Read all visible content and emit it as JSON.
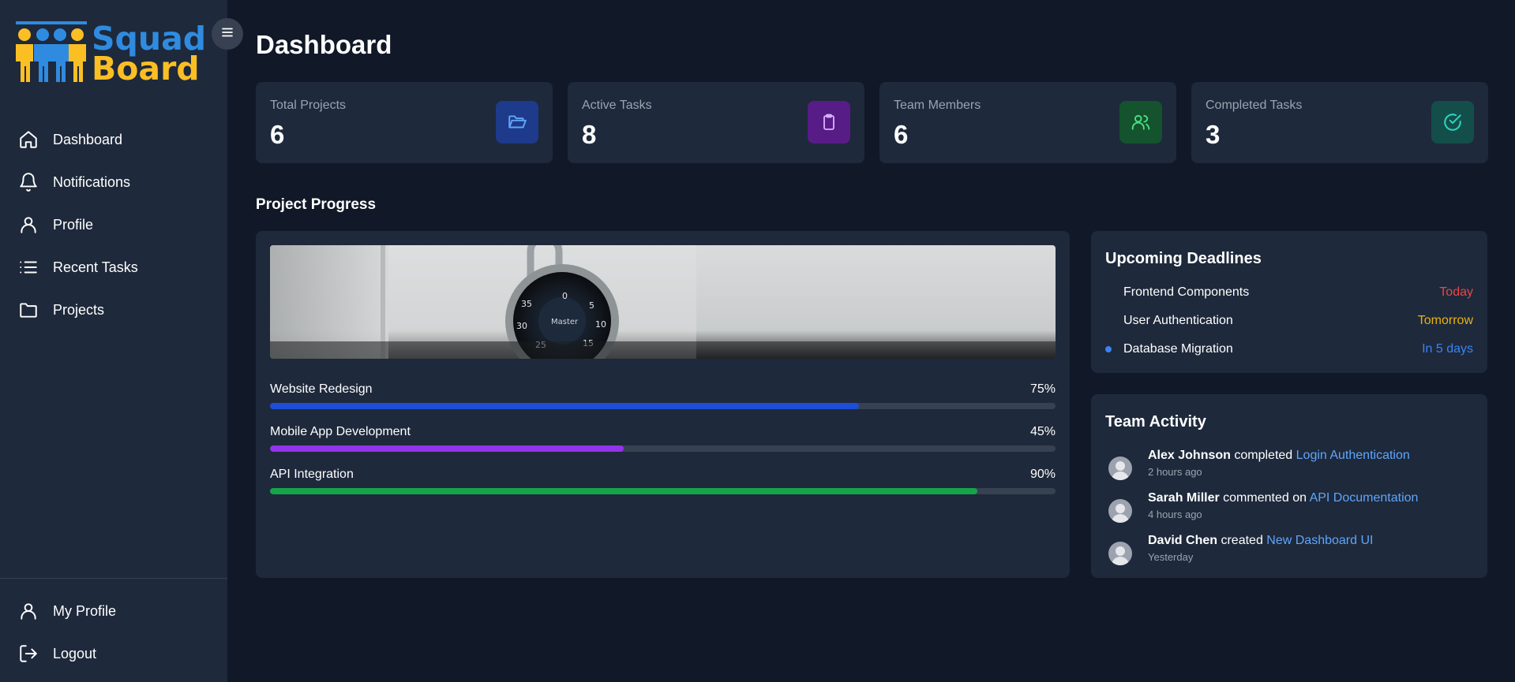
{
  "app": {
    "logo_line1": "Squad",
    "logo_line2": "Board"
  },
  "sidebar": {
    "nav": [
      {
        "label": "Dashboard",
        "icon": "home-icon"
      },
      {
        "label": "Notifications",
        "icon": "bell-icon"
      },
      {
        "label": "Profile",
        "icon": "user-icon"
      },
      {
        "label": "Recent Tasks",
        "icon": "list-icon"
      },
      {
        "label": "Projects",
        "icon": "folder-icon"
      }
    ],
    "bottom": [
      {
        "label": "My Profile",
        "icon": "user-icon"
      },
      {
        "label": "Logout",
        "icon": "logout-icon"
      }
    ]
  },
  "header": {
    "title": "Dashboard"
  },
  "stats": [
    {
      "label": "Total Projects",
      "value": "6",
      "icon": "folder-open-icon",
      "icon_bg": "#1e3a8a",
      "icon_color": "#60a5fa"
    },
    {
      "label": "Active Tasks",
      "value": "8",
      "icon": "clipboard-icon",
      "icon_bg": "#581c87",
      "icon_color": "#c084fc"
    },
    {
      "label": "Team Members",
      "value": "6",
      "icon": "users-icon",
      "icon_bg": "#14532d",
      "icon_color": "#4ade80"
    },
    {
      "label": "Completed Tasks",
      "value": "3",
      "icon": "check-circle-icon",
      "icon_bg": "#134e4a",
      "icon_color": "#2dd4bf"
    }
  ],
  "progress": {
    "title": "Project Progress",
    "projects": [
      {
        "name": "Website Redesign",
        "percent_label": "75%",
        "percent": 75,
        "color": "#1d4ed8"
      },
      {
        "name": "Mobile App Development",
        "percent_label": "45%",
        "percent": 45,
        "color": "#9333ea"
      },
      {
        "name": "API Integration",
        "percent_label": "90%",
        "percent": 90,
        "color": "#16a34a"
      }
    ]
  },
  "deadlines": {
    "title": "Upcoming Deadlines",
    "items": [
      {
        "name": "Frontend Components",
        "when": "Today",
        "color": "#ef4444",
        "dot": false
      },
      {
        "name": "User Authentication",
        "when": "Tomorrow",
        "color": "#eab308",
        "dot": false
      },
      {
        "name": "Database Migration",
        "when": "In 5 days",
        "color": "#3b82f6",
        "dot": true
      }
    ]
  },
  "activity": {
    "title": "Team Activity",
    "items": [
      {
        "who": "Alex Johnson",
        "action": "completed",
        "target": "Login Authentication",
        "time": "2 hours ago"
      },
      {
        "who": "Sarah Miller",
        "action": "commented on",
        "target": "API Documentation",
        "time": "4 hours ago"
      },
      {
        "who": "David Chen",
        "action": "created",
        "target": "New Dashboard UI",
        "time": "Yesterday"
      }
    ]
  }
}
